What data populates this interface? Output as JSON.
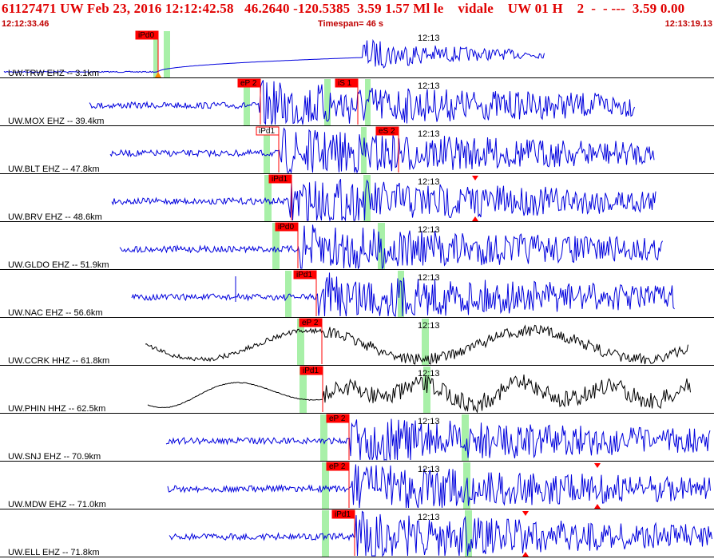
{
  "header": {
    "title": "61127471 UW Feb 23, 2016 12:12:42.58   46.2640 -120.5385  3.59 1.57 Ml le    vidale    UW 01 H    2  -  - ---  3.59 0.00",
    "start_time": "12:12:33.46",
    "timespan": "Timespan=  46 s",
    "end_time": "12:13:19.13"
  },
  "colors": {
    "title": "#e00000",
    "wave": "#0000dd",
    "wave_broadband": "#000000",
    "pick_box": "#ff0000",
    "pick_window": "#a8f0a8"
  },
  "traces": [
    {
      "label": "UW.TRW EHZ -- 3.1km",
      "time_tick": "12:13",
      "picks": [
        "iPd0"
      ],
      "color": "blue"
    },
    {
      "label": "UW.MOX EHZ -- 39.4km",
      "time_tick": "12:13",
      "picks": [
        "eP 2",
        "iS 1"
      ],
      "color": "blue"
    },
    {
      "label": "UW.BLT EHZ -- 47.8km",
      "time_tick": "12:13",
      "picks": [
        "iPd1",
        "eS 2"
      ],
      "color": "blue"
    },
    {
      "label": "UW.BRV EHZ -- 48.6km",
      "time_tick": "12:13",
      "picks": [
        "iPd1"
      ],
      "color": "blue"
    },
    {
      "label": "UW.GLDO EHZ -- 51.9km",
      "time_tick": "12:13",
      "picks": [
        "iPd0"
      ],
      "color": "blue"
    },
    {
      "label": "UW.NAC EHZ -- 56.6km",
      "time_tick": "12:13",
      "picks": [
        "iPd1"
      ],
      "color": "blue"
    },
    {
      "label": "UW.CCRK HHZ -- 61.8km",
      "time_tick": "12:13",
      "picks": [
        "eP 2"
      ],
      "color": "black"
    },
    {
      "label": "UW.PHIN HHZ -- 62.5km",
      "time_tick": "12:13",
      "picks": [
        "iPd1"
      ],
      "color": "black"
    },
    {
      "label": "UW.SNJ EHZ -- 70.9km",
      "time_tick": "12:13",
      "picks": [
        "eP 2"
      ],
      "color": "blue"
    },
    {
      "label": "UW.MDW EHZ -- 71.0km",
      "time_tick": "12:13",
      "picks": [
        "eP 2"
      ],
      "color": "blue"
    },
    {
      "label": "UW.ELL EHZ -- 71.8km",
      "time_tick": "12:13",
      "picks": [
        "iPd1"
      ],
      "color": "blue"
    }
  ]
}
